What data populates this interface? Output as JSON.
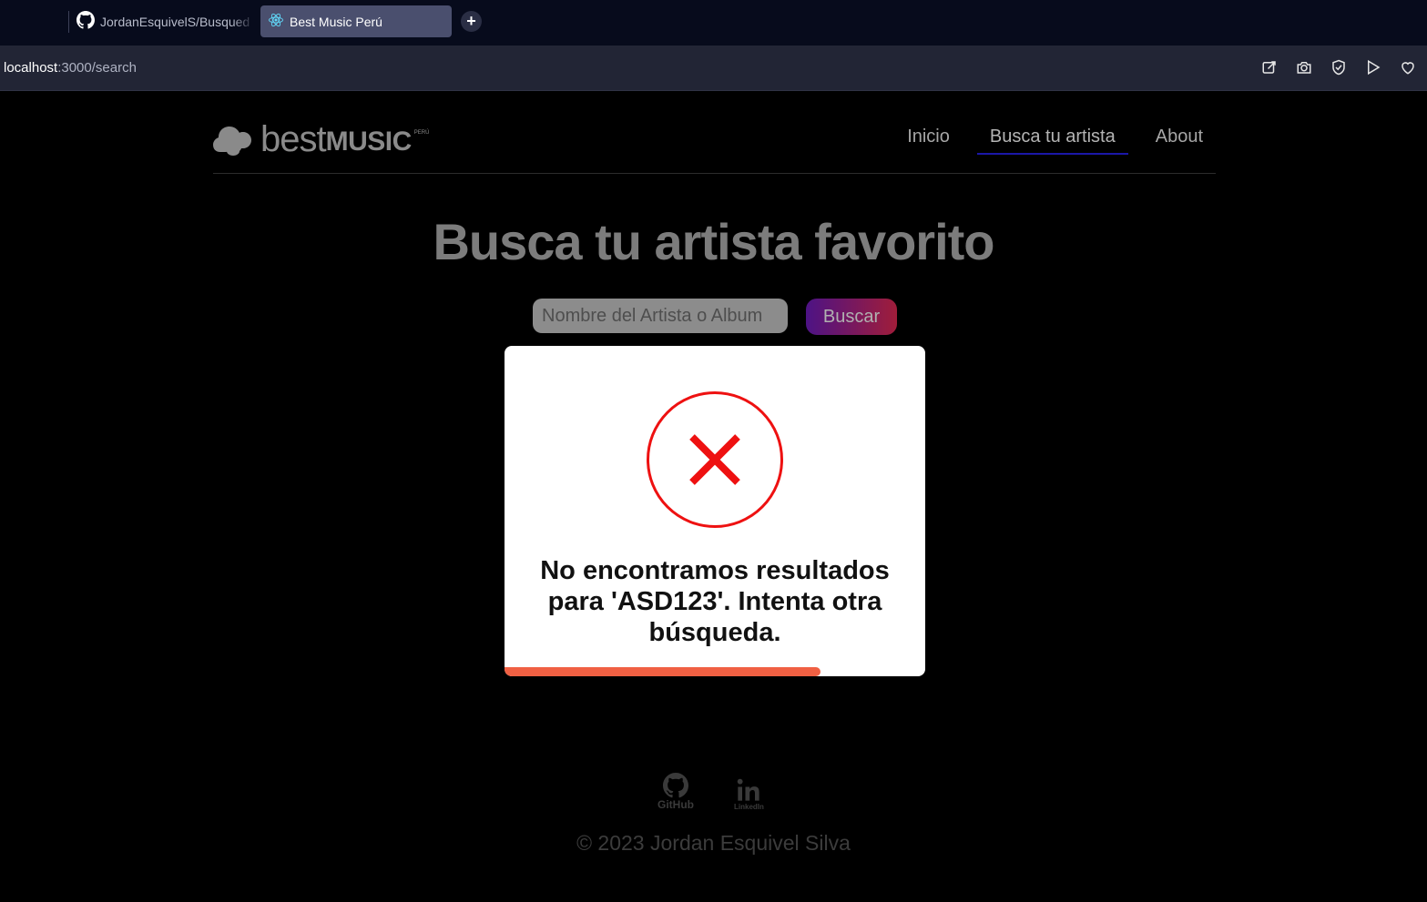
{
  "browser": {
    "tabs": [
      {
        "label": "JordanEsquivelS/Busqued",
        "icon": "github-icon",
        "active": false
      },
      {
        "label": "Best Music Perú",
        "icon": "react-icon",
        "active": true
      }
    ],
    "new_tab_label": "+",
    "url_host": "localhost",
    "url_rest": ":3000/search",
    "toolbar_icons": [
      "edit-icon",
      "camera-icon",
      "shield-icon",
      "play-icon",
      "heart-icon"
    ]
  },
  "header": {
    "logo_best": "best",
    "logo_music": "MUSIC",
    "logo_peru": "PERÚ",
    "nav": [
      {
        "label": "Inicio",
        "active": false
      },
      {
        "label": "Busca tu artista",
        "active": true
      },
      {
        "label": "About",
        "active": false
      }
    ]
  },
  "main": {
    "title": "Busca tu artista favorito",
    "search_placeholder": "Nombre del Artista o Album",
    "search_button": "Buscar"
  },
  "modal": {
    "icon": "error-x-icon",
    "message": "No encontramos resultados para 'ASD123'. Intenta otra búsqueda.",
    "progress_fraction": 0.75,
    "accent_color": "#ee1111",
    "progress_color": "#f06043"
  },
  "footer": {
    "github_label": "GitHub",
    "linkedin_label": "LinkedIn",
    "copyright": "© 2023 Jordan Esquivel Silva"
  }
}
